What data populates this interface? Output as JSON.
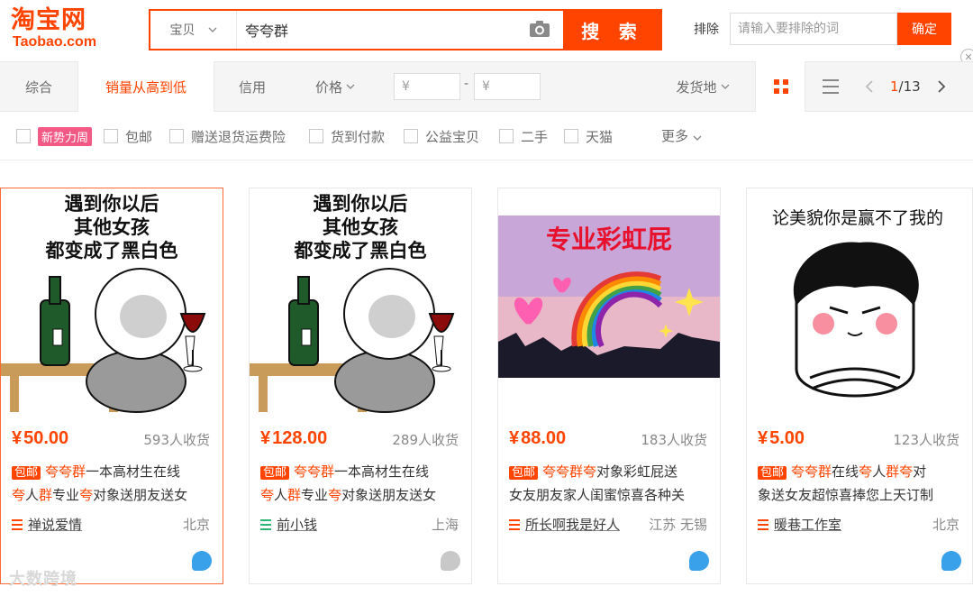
{
  "header": {
    "logo_cn": "淘宝网",
    "logo_en": "Taobao.com",
    "search_scope": "宝贝",
    "search_query": "夸夸群",
    "search_button": "搜 索",
    "exclude_label": "排除",
    "exclude_placeholder": "请输入要排除的词",
    "confirm_button": "确定"
  },
  "sortbar": {
    "tabs": [
      "综合",
      "销量从高到低",
      "信用",
      "价格"
    ],
    "active_tab": "销量从高到低",
    "price_min": "¥",
    "price_max": "¥",
    "price_dash": "-",
    "ship_from": "发货地",
    "page_current": "1",
    "page_total": "/13"
  },
  "filters": {
    "new_badge": "新势力周",
    "items": [
      "包邮",
      "赠送退货运费险",
      "货到付款",
      "公益宝贝",
      "二手",
      "天猫"
    ],
    "more": "更多"
  },
  "products": [
    {
      "price": "50.00",
      "sold": "593人收货",
      "badge": "包邮",
      "title_line1": [
        {
          "t": "夸夸群",
          "h": true
        },
        {
          "t": "一本高材生在线",
          "h": false
        }
      ],
      "title_line2": [
        {
          "t": "夸",
          "h": true
        },
        {
          "t": "人",
          "h": false
        },
        {
          "t": "群",
          "h": true
        },
        {
          "t": "专业",
          "h": false
        },
        {
          "t": "夸",
          "h": true
        },
        {
          "t": "对象送朋友送女",
          "h": false
        }
      ],
      "shop": "禅说爱情",
      "location": "北京",
      "image_text": [
        "遇到你以后",
        "其他女孩",
        "都变成了黑白色"
      ]
    },
    {
      "price": "128.00",
      "sold": "289人收货",
      "badge": "包邮",
      "title_line1": [
        {
          "t": "夸夸群",
          "h": true
        },
        {
          "t": "一本高材生在线",
          "h": false
        }
      ],
      "title_line2": [
        {
          "t": "夸",
          "h": true
        },
        {
          "t": "人",
          "h": false
        },
        {
          "t": "群",
          "h": true
        },
        {
          "t": "专业",
          "h": false
        },
        {
          "t": "夸",
          "h": true
        },
        {
          "t": "对象送朋友送女",
          "h": false
        }
      ],
      "shop": "前小钱",
      "location": "上海",
      "image_text": [
        "遇到你以后",
        "其他女孩",
        "都变成了黑白色"
      ]
    },
    {
      "price": "88.00",
      "sold": "183人收货",
      "badge": "包邮",
      "title_line1": [
        {
          "t": "夸夸群夸",
          "h": true
        },
        {
          "t": "对象彩虹屁送",
          "h": false
        }
      ],
      "title_line2": [
        {
          "t": "女友朋友家人闺蜜惊喜各种关",
          "h": false
        }
      ],
      "shop": "所长啊我是好人",
      "location": "江苏 无锡",
      "image_text": [
        "专业彩虹屁"
      ]
    },
    {
      "price": "5.00",
      "sold": "123人收货",
      "badge": "包邮",
      "title_line1": [
        {
          "t": "夸夸群",
          "h": true
        },
        {
          "t": "在线",
          "h": false
        },
        {
          "t": "夸",
          "h": true
        },
        {
          "t": "人",
          "h": false
        },
        {
          "t": "群夸",
          "h": true
        },
        {
          "t": "对",
          "h": false
        }
      ],
      "title_line2": [
        {
          "t": "象送女友超惊喜捧您上天订制",
          "h": false
        }
      ],
      "shop": "暖巷工作室",
      "location": "北京",
      "image_text": [
        "论美貌你是赢不了我的"
      ]
    }
  ],
  "currency_symbol": "¥",
  "watermark": "大数跨境",
  "colors": {
    "brand": "#ff4400",
    "badge_pink": "#f25a85",
    "wangwang_blue": "#39a1ea"
  }
}
